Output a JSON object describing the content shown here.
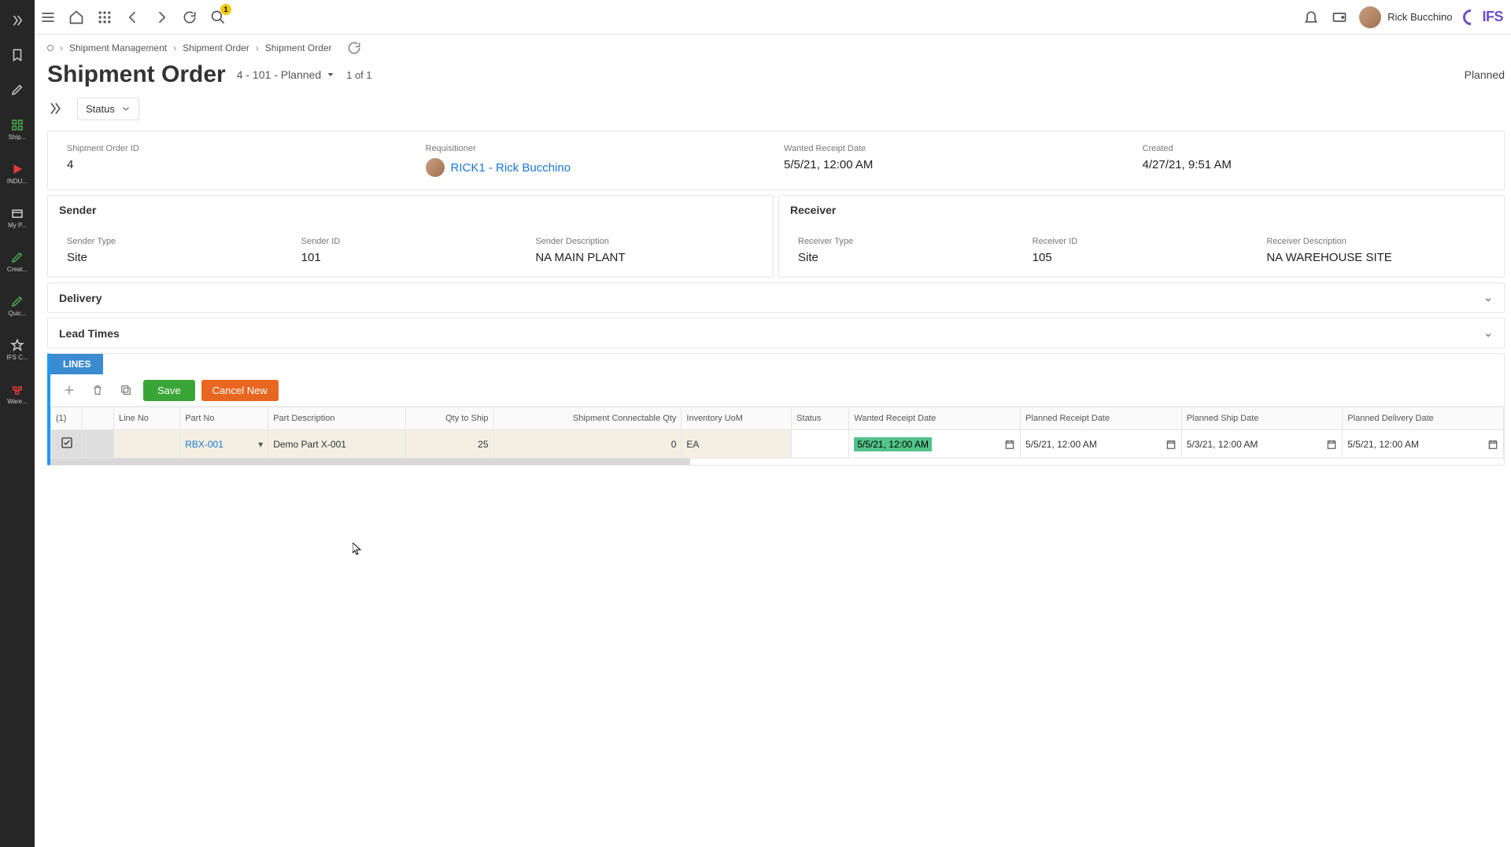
{
  "topbar": {
    "search_badge": "1",
    "user_name": "Rick Bucchino",
    "logo": "IFS"
  },
  "leftrail": {
    "items": [
      {
        "label": ""
      },
      {
        "label": ""
      },
      {
        "label": ""
      },
      {
        "label": "Ship..."
      },
      {
        "label": "INDU..."
      },
      {
        "label": "My P..."
      },
      {
        "label": "Creat..."
      },
      {
        "label": "Quic..."
      },
      {
        "label": "IFS C..."
      },
      {
        "label": "Ware..."
      }
    ]
  },
  "breadcrumb": {
    "seg1": "Shipment Management",
    "seg2": "Shipment Order",
    "seg3": "Shipment Order"
  },
  "header": {
    "title": "Shipment Order",
    "subtitle": "4 - 101 - Planned",
    "pager": "1 of 1",
    "status_right": "Planned",
    "status_dd": "Status"
  },
  "top_panel": {
    "shipment_order_id_lbl": "Shipment Order ID",
    "shipment_order_id": "4",
    "requisitioner_lbl": "Requisitioner",
    "requisitioner": "RICK1 - Rick Bucchino",
    "wanted_receipt_lbl": "Wanted Receipt Date",
    "wanted_receipt": "5/5/21, 12:00 AM",
    "created_lbl": "Created",
    "created": "4/27/21, 9:51 AM"
  },
  "sender": {
    "title": "Sender",
    "type_lbl": "Sender Type",
    "type": "Site",
    "id_lbl": "Sender ID",
    "id": "101",
    "desc_lbl": "Sender Description",
    "desc": "NA MAIN PLANT"
  },
  "receiver": {
    "title": "Receiver",
    "type_lbl": "Receiver Type",
    "type": "Site",
    "id_lbl": "Receiver ID",
    "id": "105",
    "desc_lbl": "Receiver Description",
    "desc": "NA WAREHOUSE SITE"
  },
  "delivery": {
    "title": "Delivery"
  },
  "lead_times": {
    "title": "Lead Times"
  },
  "lines": {
    "tab": "LINES",
    "save": "Save",
    "cancel": "Cancel New",
    "count": "(1)",
    "cols": {
      "line_no": "Line No",
      "part_no": "Part No",
      "part_desc": "Part Description",
      "qty_ship": "Qty to Ship",
      "ship_conn": "Shipment Connectable Qty",
      "uom": "Inventory UoM",
      "status": "Status",
      "wanted": "Wanted Receipt Date",
      "planned_receipt": "Planned Receipt Date",
      "planned_ship": "Planned Ship Date",
      "planned_delivery": "Planned Delivery Date"
    },
    "row": {
      "part_no": "RBX-001",
      "part_desc": "Demo Part X-001",
      "qty_ship": "25",
      "ship_conn": "0",
      "uom": "EA",
      "status": "",
      "wanted": "5/5/21, 12:00 AM",
      "planned_receipt": "5/5/21, 12:00 AM",
      "planned_ship": "5/3/21, 12:00 AM",
      "planned_delivery": "5/5/21, 12:00 AM"
    }
  }
}
